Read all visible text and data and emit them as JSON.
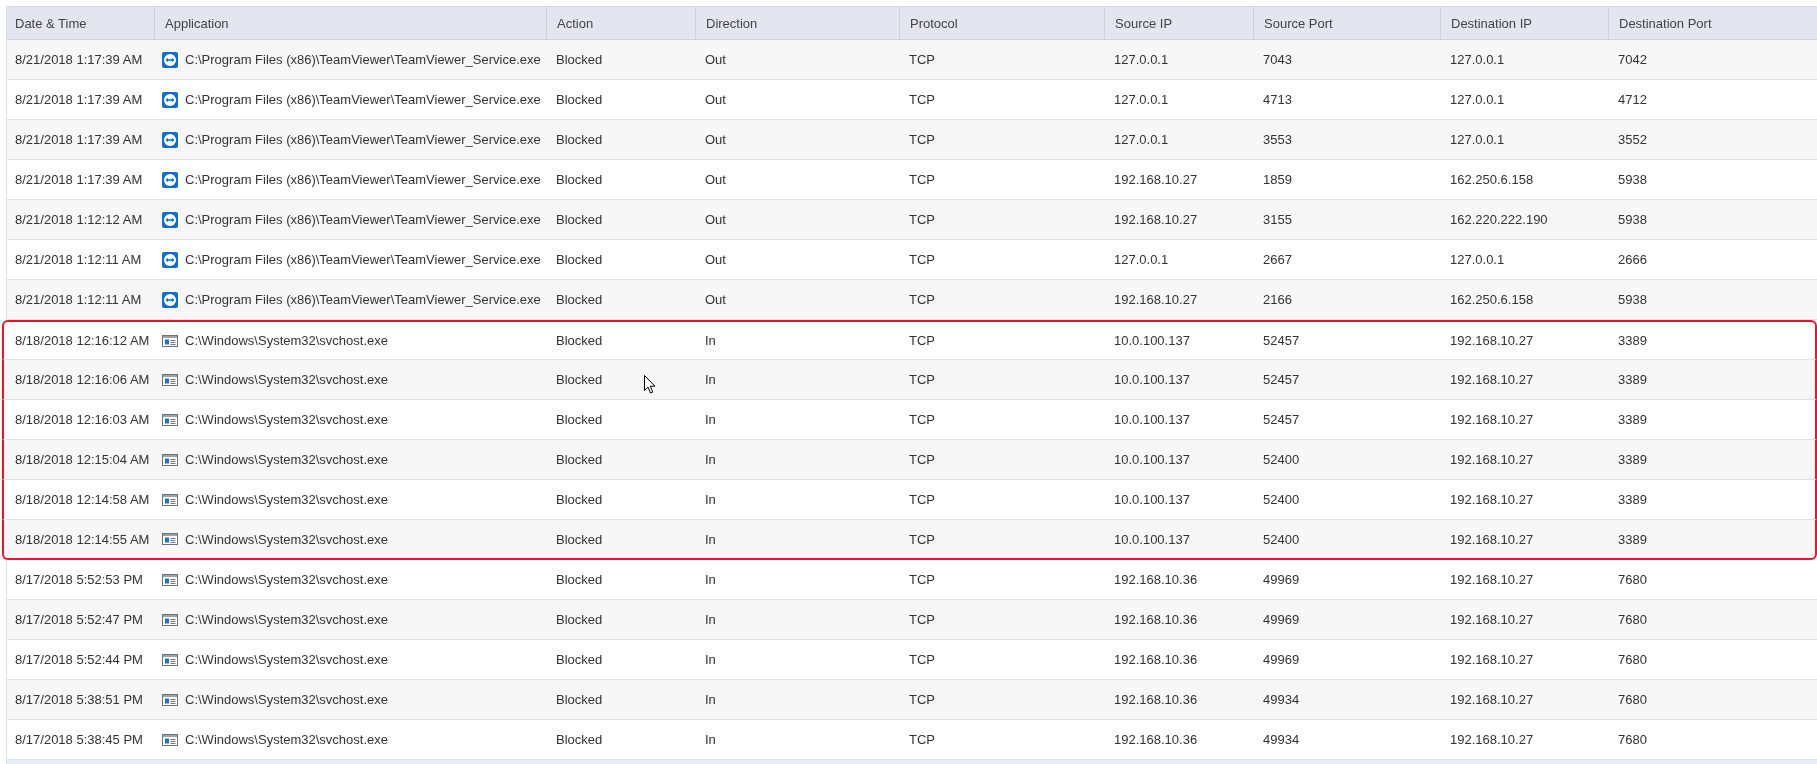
{
  "table": {
    "columns": [
      "Date & Time",
      "Application",
      "Action",
      "Direction",
      "Protocol",
      "Source IP",
      "Source Port",
      "Destination IP",
      "Destination Port"
    ],
    "rows": [
      {
        "time": "8/21/2018 1:17:39 AM",
        "kind": "arrows",
        "application": "C:\\Program Files (x86)\\TeamViewer\\TeamViewer_Service.exe",
        "action": "Blocked",
        "direction": "Out",
        "protocol": "TCP",
        "source_ip": "127.0.0.1",
        "source_port": "7043",
        "destination_ip": "127.0.0.1",
        "destination_port": "7042",
        "highlighted": false
      },
      {
        "time": "8/21/2018 1:17:39 AM",
        "kind": "arrows",
        "application": "C:\\Program Files (x86)\\TeamViewer\\TeamViewer_Service.exe",
        "action": "Blocked",
        "direction": "Out",
        "protocol": "TCP",
        "source_ip": "127.0.0.1",
        "source_port": "4713",
        "destination_ip": "127.0.0.1",
        "destination_port": "4712",
        "highlighted": false
      },
      {
        "time": "8/21/2018 1:17:39 AM",
        "kind": "arrows",
        "application": "C:\\Program Files (x86)\\TeamViewer\\TeamViewer_Service.exe",
        "action": "Blocked",
        "direction": "Out",
        "protocol": "TCP",
        "source_ip": "127.0.0.1",
        "source_port": "3553",
        "destination_ip": "127.0.0.1",
        "destination_port": "3552",
        "highlighted": false
      },
      {
        "time": "8/21/2018 1:17:39 AM",
        "kind": "arrows",
        "application": "C:\\Program Files (x86)\\TeamViewer\\TeamViewer_Service.exe",
        "action": "Blocked",
        "direction": "Out",
        "protocol": "TCP",
        "source_ip": "192.168.10.27",
        "source_port": "1859",
        "destination_ip": "162.250.6.158",
        "destination_port": "5938",
        "highlighted": false
      },
      {
        "time": "8/21/2018 1:12:12 AM",
        "kind": "arrows",
        "application": "C:\\Program Files (x86)\\TeamViewer\\TeamViewer_Service.exe",
        "action": "Blocked",
        "direction": "Out",
        "protocol": "TCP",
        "source_ip": "192.168.10.27",
        "source_port": "3155",
        "destination_ip": "162.220.222.190",
        "destination_port": "5938",
        "highlighted": false
      },
      {
        "time": "8/21/2018 1:12:11 AM",
        "kind": "arrows",
        "application": "C:\\Program Files (x86)\\TeamViewer\\TeamViewer_Service.exe",
        "action": "Blocked",
        "direction": "Out",
        "protocol": "TCP",
        "source_ip": "127.0.0.1",
        "source_port": "2667",
        "destination_ip": "127.0.0.1",
        "destination_port": "2666",
        "highlighted": false
      },
      {
        "time": "8/21/2018 1:12:11 AM",
        "kind": "arrows",
        "application": "C:\\Program Files (x86)\\TeamViewer\\TeamViewer_Service.exe",
        "action": "Blocked",
        "direction": "Out",
        "protocol": "TCP",
        "source_ip": "192.168.10.27",
        "source_port": "2166",
        "destination_ip": "162.250.6.158",
        "destination_port": "5938",
        "highlighted": false
      },
      {
        "time": "8/18/2018 12:16:12 AM",
        "kind": "window",
        "application": "C:\\Windows\\System32\\svchost.exe",
        "action": "Blocked",
        "direction": "In",
        "protocol": "TCP",
        "source_ip": "10.0.100.137",
        "source_port": "52457",
        "destination_ip": "192.168.10.27",
        "destination_port": "3389",
        "highlighted": true
      },
      {
        "time": "8/18/2018 12:16:06 AM",
        "kind": "window",
        "application": "C:\\Windows\\System32\\svchost.exe",
        "action": "Blocked",
        "direction": "In",
        "protocol": "TCP",
        "source_ip": "10.0.100.137",
        "source_port": "52457",
        "destination_ip": "192.168.10.27",
        "destination_port": "3389",
        "highlighted": true
      },
      {
        "time": "8/18/2018 12:16:03 AM",
        "kind": "window",
        "application": "C:\\Windows\\System32\\svchost.exe",
        "action": "Blocked",
        "direction": "In",
        "protocol": "TCP",
        "source_ip": "10.0.100.137",
        "source_port": "52457",
        "destination_ip": "192.168.10.27",
        "destination_port": "3389",
        "highlighted": true
      },
      {
        "time": "8/18/2018 12:15:04 AM",
        "kind": "window",
        "application": "C:\\Windows\\System32\\svchost.exe",
        "action": "Blocked",
        "direction": "In",
        "protocol": "TCP",
        "source_ip": "10.0.100.137",
        "source_port": "52400",
        "destination_ip": "192.168.10.27",
        "destination_port": "3389",
        "highlighted": true
      },
      {
        "time": "8/18/2018 12:14:58 AM",
        "kind": "window",
        "application": "C:\\Windows\\System32\\svchost.exe",
        "action": "Blocked",
        "direction": "In",
        "protocol": "TCP",
        "source_ip": "10.0.100.137",
        "source_port": "52400",
        "destination_ip": "192.168.10.27",
        "destination_port": "3389",
        "highlighted": true
      },
      {
        "time": "8/18/2018 12:14:55 AM",
        "kind": "window",
        "application": "C:\\Windows\\System32\\svchost.exe",
        "action": "Blocked",
        "direction": "In",
        "protocol": "TCP",
        "source_ip": "10.0.100.137",
        "source_port": "52400",
        "destination_ip": "192.168.10.27",
        "destination_port": "3389",
        "highlighted": true
      },
      {
        "time": "8/17/2018 5:52:53 PM",
        "kind": "window",
        "application": "C:\\Windows\\System32\\svchost.exe",
        "action": "Blocked",
        "direction": "In",
        "protocol": "TCP",
        "source_ip": "192.168.10.36",
        "source_port": "49969",
        "destination_ip": "192.168.10.27",
        "destination_port": "7680",
        "highlighted": false
      },
      {
        "time": "8/17/2018 5:52:47 PM",
        "kind": "window",
        "application": "C:\\Windows\\System32\\svchost.exe",
        "action": "Blocked",
        "direction": "In",
        "protocol": "TCP",
        "source_ip": "192.168.10.36",
        "source_port": "49969",
        "destination_ip": "192.168.10.27",
        "destination_port": "7680",
        "highlighted": false
      },
      {
        "time": "8/17/2018 5:52:44 PM",
        "kind": "window",
        "application": "C:\\Windows\\System32\\svchost.exe",
        "action": "Blocked",
        "direction": "In",
        "protocol": "TCP",
        "source_ip": "192.168.10.36",
        "source_port": "49969",
        "destination_ip": "192.168.10.27",
        "destination_port": "7680",
        "highlighted": false
      },
      {
        "time": "8/17/2018 5:38:51 PM",
        "kind": "window",
        "application": "C:\\Windows\\System32\\svchost.exe",
        "action": "Blocked",
        "direction": "In",
        "protocol": "TCP",
        "source_ip": "192.168.10.36",
        "source_port": "49934",
        "destination_ip": "192.168.10.27",
        "destination_port": "7680",
        "highlighted": false
      },
      {
        "time": "8/17/2018 5:38:45 PM",
        "kind": "window",
        "application": "C:\\Windows\\System32\\svchost.exe",
        "action": "Blocked",
        "direction": "In",
        "protocol": "TCP",
        "source_ip": "192.168.10.36",
        "source_port": "49934",
        "destination_ip": "192.168.10.27",
        "destination_port": "7680",
        "highlighted": false
      }
    ]
  }
}
